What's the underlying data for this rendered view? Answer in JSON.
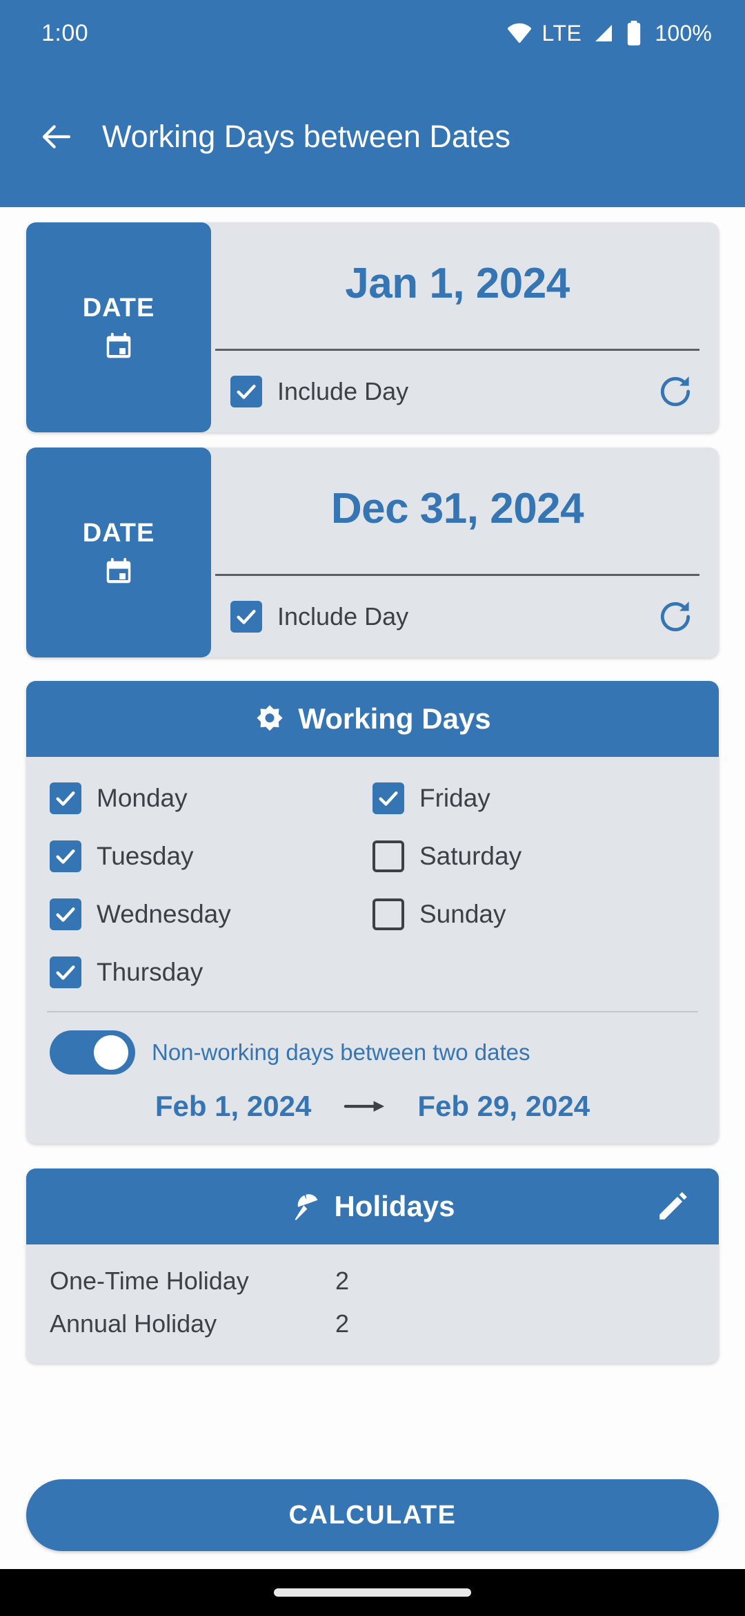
{
  "status_bar": {
    "time": "1:00",
    "network": "LTE",
    "battery": "100%",
    "icons": [
      "wifi-icon",
      "signal-icon",
      "battery-icon"
    ]
  },
  "app_bar": {
    "back_icon": "back-arrow-icon",
    "title": "Working Days between Dates"
  },
  "colors": {
    "primary": "#3575b3",
    "card_surface": "#e1e5e9",
    "page_background": "#fdfdfd",
    "text_dark": "#3c4147",
    "nav_background": "#000000"
  },
  "date_cards": [
    {
      "tab_label": "DATE",
      "tab_icon": "calendar-icon",
      "value": "Jan 1, 2024",
      "include_label": "Include Day",
      "include_checked": true,
      "reset_icon": "refresh-icon"
    },
    {
      "tab_label": "DATE",
      "tab_icon": "calendar-icon",
      "value": "Dec 31, 2024",
      "include_label": "Include Day",
      "include_checked": true,
      "reset_icon": "refresh-icon"
    }
  ],
  "working_days": {
    "header": {
      "icon": "sun-icon",
      "title": "Working Days"
    },
    "days": [
      {
        "label": "Monday",
        "checked": true
      },
      {
        "label": "Friday",
        "checked": true
      },
      {
        "label": "Tuesday",
        "checked": true
      },
      {
        "label": "Saturday",
        "checked": false
      },
      {
        "label": "Wednesday",
        "checked": true
      },
      {
        "label": "Sunday",
        "checked": false
      },
      {
        "label": "Thursday",
        "checked": true
      }
    ],
    "toggle": {
      "label": "Non-working days between two dates",
      "on": true
    },
    "range": {
      "start": "Feb 1, 2024",
      "arrow_icon": "arrow-right-icon",
      "end": "Feb 29, 2024"
    }
  },
  "holidays": {
    "header": {
      "icon": "beach-umbrella-icon",
      "title": "Holidays",
      "edit_icon": "pencil-icon"
    },
    "rows": [
      {
        "name": "One-Time Holiday",
        "count": "2"
      },
      {
        "name": "Annual Holiday",
        "count": "2"
      }
    ]
  },
  "actions": {
    "calculate_label": "CALCULATE"
  }
}
